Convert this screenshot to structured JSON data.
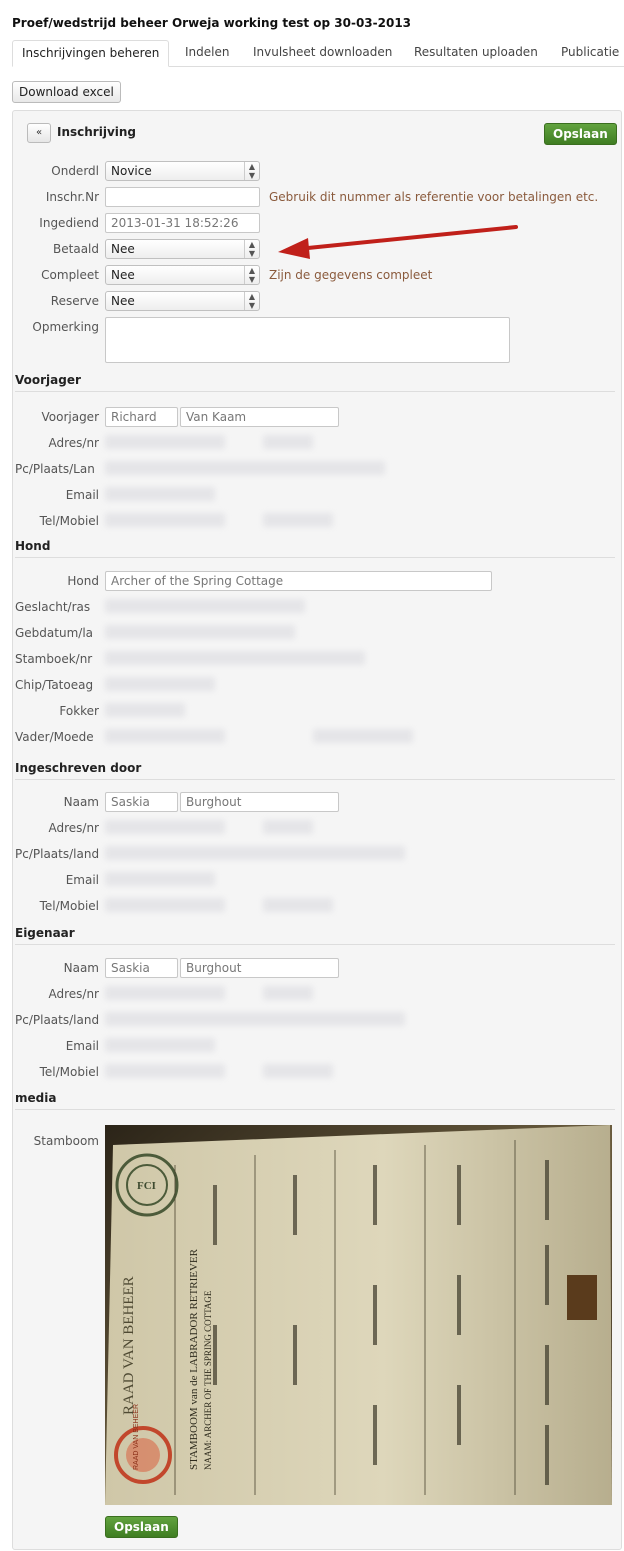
{
  "page_title": "Proef/wedstrijd beheer Orweja working test op 30-03-2013",
  "tabs": [
    "Inschrijvingen beheren",
    "Indelen",
    "Invulsheet downloaden",
    "Resultaten uploaden",
    "Publicatie"
  ],
  "download_label": "Download excel",
  "panel": {
    "back_icon": "«",
    "title": "Inschrijving",
    "save_label": "Opslaan"
  },
  "form": {
    "onderdl_label": "Onderdl",
    "onderdl_value": "Novice",
    "inschr_label": "Inschr.Nr",
    "inschr_value": "",
    "inschr_hint": "Gebruik dit nummer als referentie voor betalingen etc.",
    "ingediend_label": "Ingediend",
    "ingediend_value": "2013-01-31 18:52:26",
    "betaald_label": "Betaald",
    "betaald_value": "Nee",
    "compleet_label": "Compleet",
    "compleet_value": "Nee",
    "compleet_hint": "Zijn de gegevens compleet",
    "reserve_label": "Reserve",
    "reserve_value": "Nee",
    "opmerking_label": "Opmerking"
  },
  "voorjager": {
    "section": "Voorjager",
    "name_label": "Voorjager",
    "first": "Richard",
    "last": "Van Kaam",
    "adres_label": "Adres/nr",
    "pc_label": "Pc/Plaats/Lan",
    "email_label": "Email",
    "tel_label": "Tel/Mobiel"
  },
  "hond": {
    "section": "Hond",
    "hond_label": "Hond",
    "hond_value": "Archer of the Spring Cottage",
    "geslacht_label": "Geslacht/ras",
    "gebdatum_label": "Gebdatum/la",
    "stamboek_label": "Stamboek/nr",
    "chip_label": "Chip/Tatoeag",
    "fokker_label": "Fokker",
    "vader_label": "Vader/Moede"
  },
  "ingeschreven": {
    "section": "Ingeschreven door",
    "naam_label": "Naam",
    "first": "Saskia",
    "last": "Burghout",
    "adres_label": "Adres/nr",
    "pc_label": "Pc/Plaats/land",
    "email_label": "Email",
    "tel_label": "Tel/Mobiel"
  },
  "eigenaar": {
    "section": "Eigenaar",
    "naam_label": "Naam",
    "first": "Saskia",
    "last": "Burghout",
    "adres_label": "Adres/nr",
    "pc_label": "Pc/Plaats/land",
    "email_label": "Email",
    "tel_label": "Tel/Mobiel"
  },
  "media": {
    "section": "media",
    "stamboom_label": "Stamboom",
    "doc_fci": "FCI",
    "doc_org": "RAAD VAN BEHEER",
    "doc_stamboom": "STAMBOOM van de LABRADOR RETRIEVER",
    "doc_naam": "NAAM: ARCHER OF THE SPRING COTTAGE",
    "doc_seal": "RAAD VAN BEHEER"
  },
  "footer_save": "Opslaan"
}
